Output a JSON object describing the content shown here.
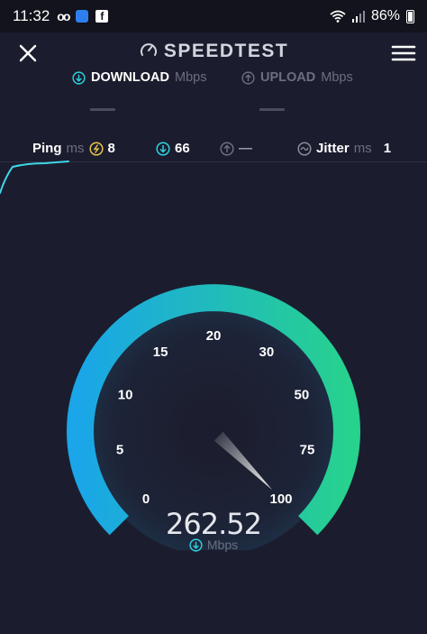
{
  "status_bar": {
    "time": "11:32",
    "voicemail_icon": "oo",
    "fb_glyph": "f",
    "battery_pct": "86%"
  },
  "header": {
    "title": "SPEEDTEST"
  },
  "tabs": {
    "download_label": "DOWNLOAD",
    "download_unit": "Mbps",
    "upload_label": "UPLOAD",
    "upload_unit": "Mbps"
  },
  "stats": {
    "ping_label": "Ping",
    "ping_unit": "ms",
    "ping_value": "8",
    "download_value": "66",
    "upload_value": "—",
    "jitter_label": "Jitter",
    "jitter_unit": "ms",
    "jitter_value": "1"
  },
  "gauge": {
    "tick_labels": [
      "0",
      "5",
      "10",
      "15",
      "20",
      "30",
      "50",
      "75",
      "100"
    ],
    "speed_value": "262.52",
    "speed_unit": "Mbps",
    "needle_value": 100
  },
  "colors": {
    "background": "#1b1d2e",
    "arc_start": "#1aa6e8",
    "arc_end": "#27d18e",
    "accent": "#2fd3e0"
  }
}
